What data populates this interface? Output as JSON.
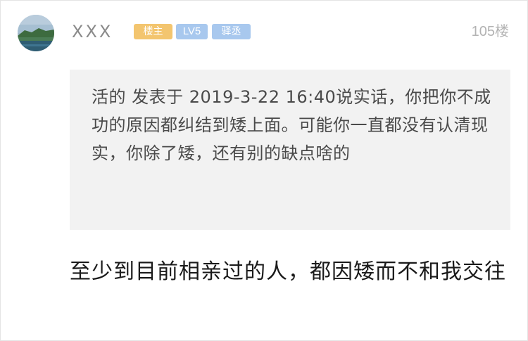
{
  "post": {
    "author": {
      "name": "XXX",
      "avatar": "avatar-landscape"
    },
    "badges": {
      "owner": "楼主",
      "level": "LV5",
      "title": "驿丞"
    },
    "floor": "105楼",
    "quote": {
      "text": "活的 发表于 2019-3-22 16:40说实话，你把你不成功的原因都纠结到矮上面。可能你一直都没有认清现实，你除了矮，还有别的缺点啥的"
    },
    "reply": "至少到目前相亲过的人，都因矮而不和我交往"
  },
  "colors": {
    "owner_badge": "#f3c56f",
    "level_badge": "#a8c8ee",
    "quote_background": "#f2f2f2"
  }
}
